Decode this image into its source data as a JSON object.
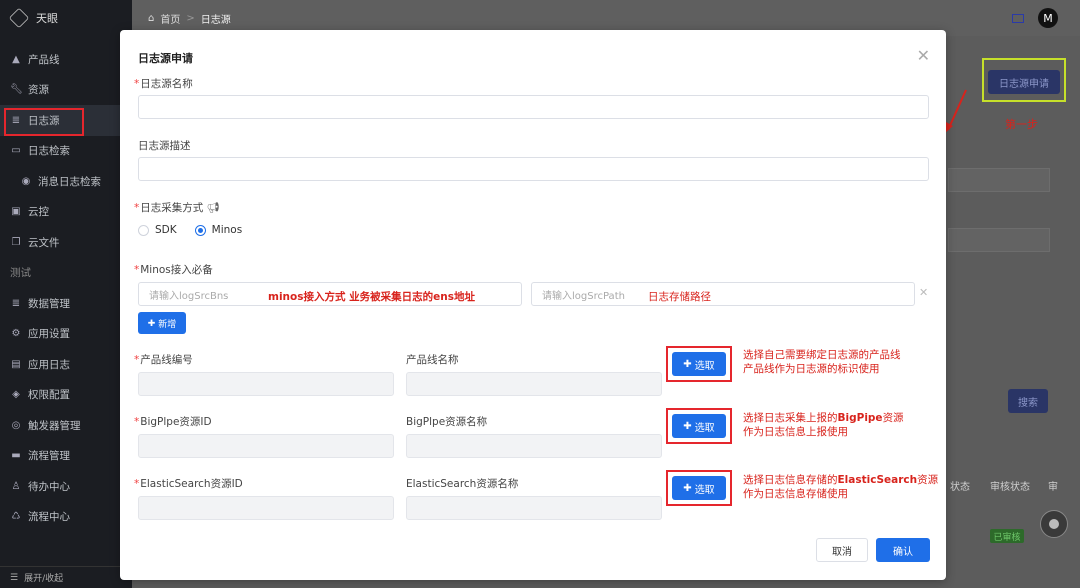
{
  "app": {
    "name": "天眼"
  },
  "sidebar": {
    "items": [
      {
        "label": "产品线",
        "icon": "product-line-icon"
      },
      {
        "label": "资源",
        "icon": "wrench-icon"
      },
      {
        "label": "日志源",
        "icon": "database-icon"
      },
      {
        "label": "日志检索",
        "icon": "search-log-icon"
      },
      {
        "label": "消息日志检索",
        "icon": "eye-icon"
      },
      {
        "label": "云控",
        "icon": "cloud-control-icon"
      },
      {
        "label": "云文件",
        "icon": "files-icon"
      },
      {
        "label": "测试",
        "icon": ""
      },
      {
        "label": "数据管理",
        "icon": "data-icon"
      },
      {
        "label": "应用设置",
        "icon": "gear-icon"
      },
      {
        "label": "应用日志",
        "icon": "app-log-icon"
      },
      {
        "label": "权限配置",
        "icon": "shield-icon"
      },
      {
        "label": "触发器管理",
        "icon": "trigger-icon"
      },
      {
        "label": "流程管理",
        "icon": "folder-icon"
      },
      {
        "label": "待办中心",
        "icon": "todo-icon"
      },
      {
        "label": "流程中心",
        "icon": "flow-icon"
      }
    ],
    "collapse_label": "展开/收起"
  },
  "breadcrumb": {
    "home": "首页",
    "current": "日志源"
  },
  "user": {
    "avatar_letter": "M"
  },
  "page": {
    "apply_button": "日志源申请",
    "step_annotation": "第一步",
    "search_button": "搜索",
    "columns": [
      "状态",
      "审核状态",
      "审"
    ],
    "status_badge": "已审核"
  },
  "modal": {
    "title": "日志源申请",
    "name_label": "日志源名称",
    "desc_label": "日志源描述",
    "method_label": "日志采集方式",
    "radio_sdk": "SDK",
    "radio_minos": "Minos",
    "minos_label": "Minos接入必备",
    "bns_placeholder": "请输入logSrcBns",
    "path_placeholder": "请输入logSrcPath",
    "bns_annotation": "minos接入方式  业务被采集日志的ens地址",
    "path_annotation": "日志存储路径",
    "add_button": "新增",
    "product_id_label": "产品线编号",
    "product_name_label": "产品线名称",
    "bigpipe_id_label": "BigPlpe资源ID",
    "bigpipe_name_label": "BigPlpe资源名称",
    "es_id_label": "ElasticSearch资源ID",
    "es_name_label": "ElasticSearch资源名称",
    "pick_button": "选取",
    "annotation_product_1": "选择自己需要绑定日志源的产品线",
    "annotation_product_2": "产品线作为日志源的标识使用",
    "annotation_bigpipe_1a": "选择日志采集上报的",
    "annotation_bigpipe_1b": "BigPipe",
    "annotation_bigpipe_1c": "资源",
    "annotation_bigpipe_2": "作为日志信息上报使用",
    "annotation_es_1a": "选择日志信息存储的",
    "annotation_es_1b": "ElasticSearch",
    "annotation_es_1c": "资源",
    "annotation_es_2": "作为日志信息存储使用",
    "cancel_button": "取消",
    "confirm_button": "确认"
  },
  "colors": {
    "primary": "#1f6fe8",
    "annotation_red": "#d8231c",
    "highlight_green": "#c6e02a"
  }
}
